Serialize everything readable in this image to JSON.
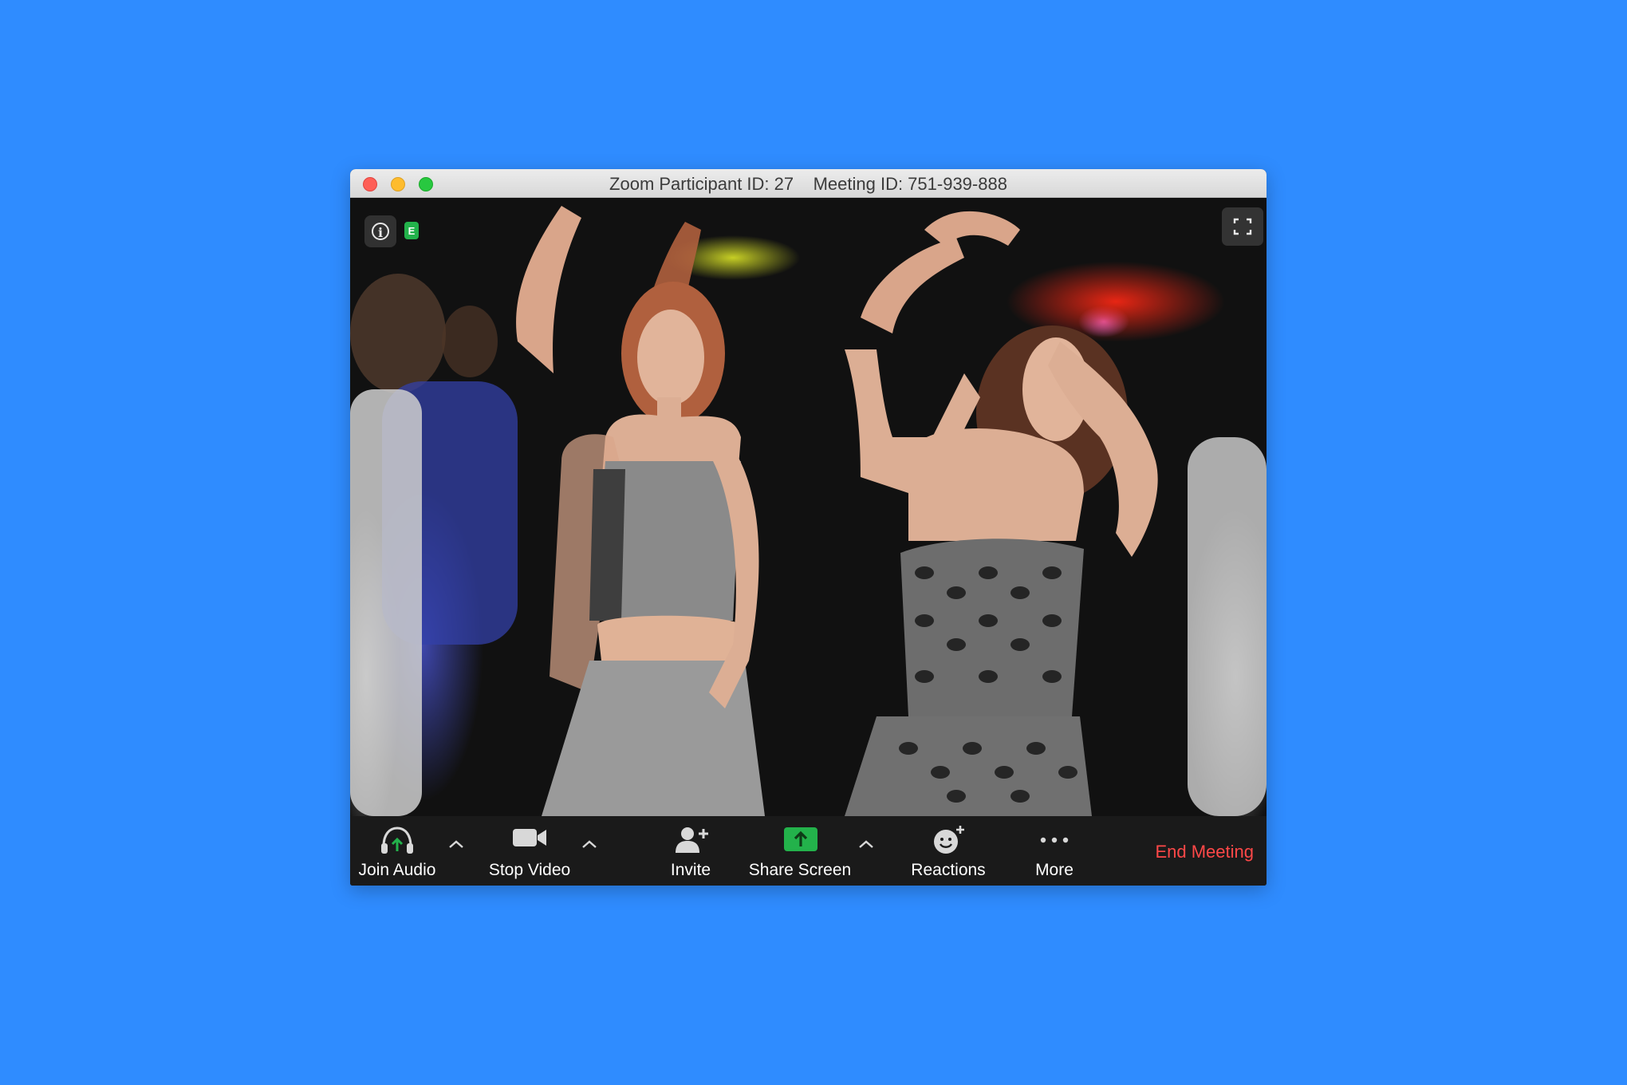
{
  "window": {
    "title": "Zoom Participant ID: 27    Meeting ID: 751-939-888"
  },
  "video": {
    "encryption_badge": "E"
  },
  "toolbar": {
    "join_audio": "Join Audio",
    "stop_video": "Stop Video",
    "invite": "Invite",
    "share_screen": "Share Screen",
    "reactions": "Reactions",
    "more": "More",
    "end_meeting": "End Meeting"
  },
  "colors": {
    "desktop_background": "#2f8cff",
    "toolbar_background": "#1a1a1a",
    "end_meeting": "#ff4848",
    "share_green": "#23b24b"
  }
}
